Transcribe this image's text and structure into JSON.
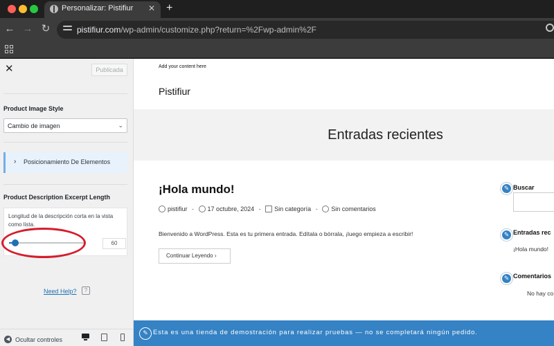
{
  "browser": {
    "tab_title": "Personalizar: Pistifiur",
    "tab_close": "✕",
    "new_tab": "+",
    "url_host": "pistifiur.com",
    "url_path": "/wp-admin/customize.php?return=%2Fwp-admin%2F"
  },
  "customizer": {
    "close": "✕",
    "publish_label": "Publicada",
    "image_style_label": "Product Image Style",
    "image_style_value": "Cambio de imagen",
    "panel_label": "Posicionamiento De Elementos",
    "excerpt_label": "Product Description Excerpt Length",
    "excerpt_description": "Longitud de la descripción corta en la vista como lista.",
    "excerpt_value": "60",
    "slider_fraction": 0.08,
    "help_label": "Need Help?",
    "help_icon_glyph": "?",
    "hide_controls": "Ocultar controles",
    "active_device": "desktop"
  },
  "preview": {
    "top_note": "Add your content here",
    "site_title": "Pistifiur",
    "hero_title": "Entradas recientes",
    "post_title": "¡Hola mundo!",
    "meta_author": "pistifiur",
    "meta_date": "17 octubre, 2024",
    "meta_category": "Sin categoría",
    "meta_comments": "Sin comentarios",
    "meta_sep": "-",
    "excerpt": "Bienvenido a WordPress. Esta es tu primera entrada. Edítala o bórrala, ¡luego empieza a escribir!",
    "read_more": "Continuar Leyendo",
    "read_more_arrow": "›",
    "widgets": {
      "search_title": "Buscar",
      "recent_title": "Entradas rec",
      "recent_item": "¡Hola mundo!",
      "comments_title": "Comentarios",
      "comments_item": "No hay co"
    },
    "notice": "Esta es una tienda de demostración para realizar pruebas — no se completará ningún pedido."
  },
  "colors": {
    "accent": "#2271b1",
    "notice_bg": "#3582c4",
    "annotation": "#d51d2c"
  }
}
